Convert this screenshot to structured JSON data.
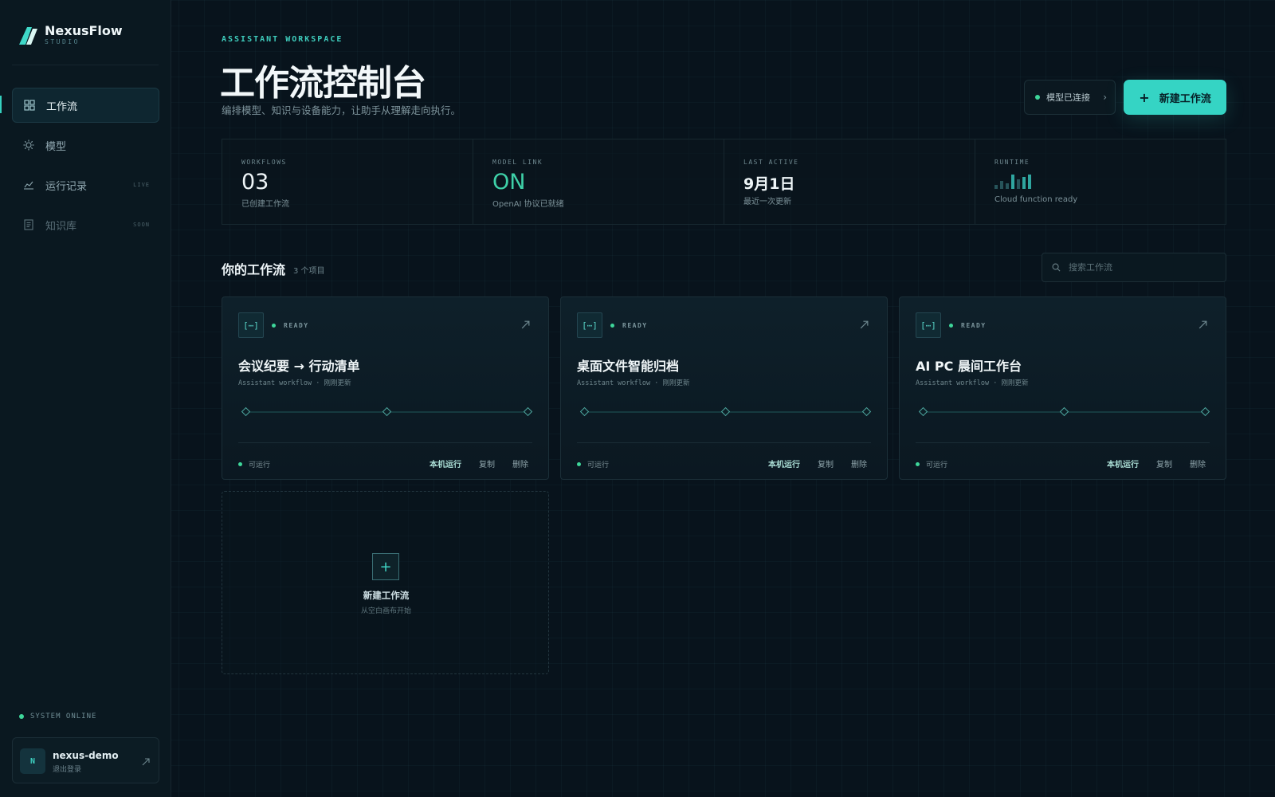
{
  "brand": {
    "name": "NexusFlow",
    "sub": "STUDIO"
  },
  "sidebar": {
    "items": [
      {
        "label": "工作流",
        "tag": "",
        "icon": "grid-icon"
      },
      {
        "label": "模型",
        "tag": "",
        "icon": "sun-icon"
      },
      {
        "label": "运行记录",
        "tag": "LIVE",
        "icon": "chart-line-icon"
      },
      {
        "label": "知识库",
        "tag": "SOON",
        "icon": "document-icon"
      }
    ],
    "system_status": "SYSTEM ONLINE",
    "user": {
      "initial": "N",
      "name": "nexus-demo",
      "action": "退出登录"
    }
  },
  "header": {
    "eyebrow": "ASSISTANT WORKSPACE",
    "title": "工作流控制台",
    "subtitle": "编排模型、知识与设备能力，让助手从理解走向执行。",
    "model_status": "模型已连接",
    "new_button": "新建工作流"
  },
  "stats": [
    {
      "label": "WORKFLOWS",
      "value": "03",
      "sub": "已创建工作流"
    },
    {
      "label": "MODEL LINK",
      "value": "ON",
      "sub": "OpenAI 协议已就绪"
    },
    {
      "label": "LAST ACTIVE",
      "value": "9月1日",
      "sub": "最近一次更新"
    },
    {
      "label": "RUNTIME",
      "value": "",
      "sub": "Cloud function ready"
    }
  ],
  "section": {
    "title": "你的工作流",
    "count": "3 个项目",
    "search_placeholder": "搜索工作流"
  },
  "workflows": [
    {
      "icon_text": "[⋯]",
      "status": "READY",
      "title": "会议纪要 → 行动清单",
      "meta": "Assistant workflow · 刚刚更新",
      "foot_status": "可运行",
      "run": "本机运行",
      "copy": "复制",
      "delete": "删除"
    },
    {
      "icon_text": "[⋯]",
      "status": "READY",
      "title": "桌面文件智能归档",
      "meta": "Assistant workflow · 刚刚更新",
      "foot_status": "可运行",
      "run": "本机运行",
      "copy": "复制",
      "delete": "删除"
    },
    {
      "icon_text": "[⋯]",
      "status": "READY",
      "title": "AI PC 晨间工作台",
      "meta": "Assistant workflow · 刚刚更新",
      "foot_status": "可运行",
      "run": "本机运行",
      "copy": "复制",
      "delete": "删除"
    }
  ],
  "new_card": {
    "title": "新建工作流",
    "sub": "从空白画布开始"
  },
  "colors": {
    "accent": "#35d4c4",
    "online": "#3ed69a",
    "background": "#08131c"
  }
}
